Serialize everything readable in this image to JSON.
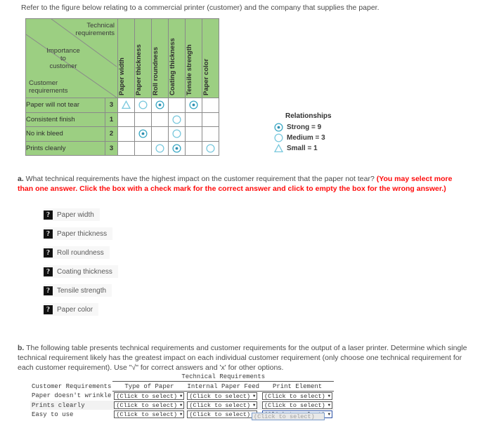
{
  "intro": "Refer to the figure below relating to a commercial printer (customer) and the company that supplies the paper.",
  "matrix": {
    "corner": {
      "technical": "Technical\nrequirements",
      "importance": "Importance\nto\ncustomer",
      "customer": "Customer\nrequirements"
    },
    "columns": [
      "Paper width",
      "Paper thickness",
      "Roll roundness",
      "Coating thickness",
      "Tensile strength",
      "Paper color"
    ],
    "importance_header": "",
    "rows": [
      {
        "label": "Paper will not tear",
        "importance": "3",
        "cells": [
          "small",
          "medium",
          "strong",
          "",
          "strong",
          ""
        ]
      },
      {
        "label": "Consistent finish",
        "importance": "1",
        "cells": [
          "",
          "",
          "",
          "medium",
          "",
          ""
        ]
      },
      {
        "label": "No ink bleed",
        "importance": "2",
        "cells": [
          "",
          "strong",
          "",
          "medium",
          "",
          ""
        ]
      },
      {
        "label": "Prints cleanly",
        "importance": "3",
        "cells": [
          "",
          "",
          "medium",
          "strong",
          "",
          "medium"
        ]
      }
    ],
    "header_fill": "#9ccf82",
    "symbol_color": "#3aa8c4"
  },
  "legend": {
    "title": "Relationships",
    "items": [
      {
        "symbol": "strong",
        "text": "Strong = 9"
      },
      {
        "symbol": "medium",
        "text": "Medium = 3"
      },
      {
        "symbol": "small",
        "text": "Small = 1"
      }
    ]
  },
  "question_a": {
    "marker": "a.",
    "text": " What technical requirements have the highest impact on the customer requirement that the paper not tear? ",
    "instruction": "(You may select more than one answer. Click the box with a check mark for the correct answer and click to empty the box for the wrong answer.)",
    "instruction_color": "#ff0a0a",
    "options": [
      {
        "label": "Paper width"
      },
      {
        "label": "Paper thickness"
      },
      {
        "label": "Roll roundness"
      },
      {
        "label": "Coating thickness"
      },
      {
        "label": "Tensile strength"
      },
      {
        "label": "Paper color"
      }
    ]
  },
  "question_b": {
    "marker": "b.",
    "text": " The following table presents technical requirements and customer requirements for the output of a laser printer. Determine which single technical requirement likely has the greatest impact on each individual customer requirement (only choose one technical requirement for each customer requirement). Use \"√\" for correct answers and 'x' for other options."
  },
  "bottom_table": {
    "group_header": "Technical Requirements",
    "row_header_label": "Customer Requirements",
    "columns": [
      "Type of Paper",
      "Internal Paper Feed",
      "Print Element"
    ],
    "placeholder": "(Click to select)",
    "caret": "▼",
    "rows": [
      {
        "label": "Paper doesn't wrinkle",
        "values": [
          "(Click to select)",
          "(Click to select)",
          "(Click to select)"
        ]
      },
      {
        "label": "Prints clearly",
        "values": [
          "(Click to select)",
          "(Click to select)",
          "(Click to select)"
        ]
      },
      {
        "label": "Easy to use",
        "values": [
          "(Click to select)",
          "(Click to select)",
          "(Click to select)"
        ]
      }
    ],
    "open_dropdown_option": "(Click to select)"
  }
}
